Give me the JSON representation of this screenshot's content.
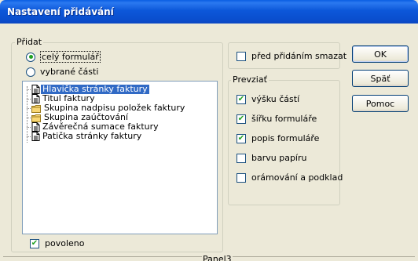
{
  "window": {
    "title": "Nastavení přidávání"
  },
  "pridat_group": {
    "legend": "Přidat",
    "radio_whole": "celý formulář",
    "radio_selected": "vybrané části",
    "selected_radio": "whole",
    "tree_items": [
      {
        "label": "Hlavička stránky faktury",
        "icon": "document-icon",
        "selected": true
      },
      {
        "label": "Titul faktury",
        "icon": "document-icon",
        "selected": false
      },
      {
        "label": "Skupina nadpisu položek faktury",
        "icon": "folder-icon",
        "selected": false
      },
      {
        "label": "Skupina zaúčtování",
        "icon": "folder-icon",
        "selected": false
      },
      {
        "label": "Závěrečná sumace faktury",
        "icon": "document-icon",
        "selected": false
      },
      {
        "label": "Patička stránky faktury",
        "icon": "document-icon",
        "selected": false
      }
    ],
    "enabled_label": "povoleno",
    "enabled_checked": true
  },
  "delete_box": {
    "label": "před přidáním smazat",
    "checked": false
  },
  "prevziat_group": {
    "legend": "Prevziať",
    "options": [
      {
        "label": "výšku částí",
        "checked": true
      },
      {
        "label": "šířku formuláře",
        "checked": true
      },
      {
        "label": "popis formuláře",
        "checked": true
      },
      {
        "label": "barvu papíru",
        "checked": false
      },
      {
        "label": "orámování a podklad",
        "checked": false
      }
    ]
  },
  "buttons": {
    "ok": "OK",
    "back": "Späť",
    "help": "Pomoc"
  },
  "status": {
    "panel": "Panel3"
  },
  "colors": {
    "title_bar": "#0a4fcf",
    "selection": "#316ac5",
    "dialog_bg": "#ece9d8"
  }
}
